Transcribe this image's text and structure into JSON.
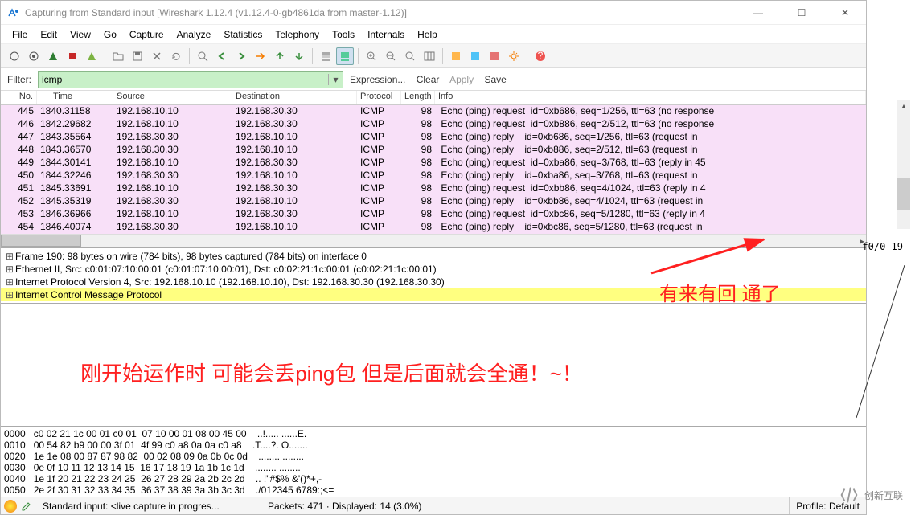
{
  "title": "Capturing from Standard input    [Wireshark 1.12.4  (v1.12.4-0-gb4861da from master-1.12)]",
  "menu": [
    "File",
    "Edit",
    "View",
    "Go",
    "Capture",
    "Analyze",
    "Statistics",
    "Telephony",
    "Tools",
    "Internals",
    "Help"
  ],
  "filter": {
    "label": "Filter:",
    "value": "icmp",
    "links": {
      "expr": "Expression...",
      "clear": "Clear",
      "apply": "Apply",
      "save": "Save"
    }
  },
  "cols": {
    "no": "No.",
    "time": "Time",
    "source": "Source",
    "dest": "Destination",
    "proto": "Protocol",
    "len": "Length",
    "info": "Info"
  },
  "packets": [
    {
      "no": "445",
      "time": "1840.31158",
      "src": "192.168.10.10",
      "dst": "192.168.30.30",
      "proto": "ICMP",
      "len": "98",
      "info": "Echo (ping) request  id=0xb686, seq=1/256, ttl=63 (no response"
    },
    {
      "no": "446",
      "time": "1842.29682",
      "src": "192.168.10.10",
      "dst": "192.168.30.30",
      "proto": "ICMP",
      "len": "98",
      "info": "Echo (ping) request  id=0xb886, seq=2/512, ttl=63 (no response"
    },
    {
      "no": "447",
      "time": "1843.35564",
      "src": "192.168.30.30",
      "dst": "192.168.10.10",
      "proto": "ICMP",
      "len": "98",
      "info": "Echo (ping) reply    id=0xb686, seq=1/256, ttl=63 (request in "
    },
    {
      "no": "448",
      "time": "1843.36570",
      "src": "192.168.30.30",
      "dst": "192.168.10.10",
      "proto": "ICMP",
      "len": "98",
      "info": "Echo (ping) reply    id=0xb886, seq=2/512, ttl=63 (request in "
    },
    {
      "no": "449",
      "time": "1844.30141",
      "src": "192.168.10.10",
      "dst": "192.168.30.30",
      "proto": "ICMP",
      "len": "98",
      "info": "Echo (ping) request  id=0xba86, seq=3/768, ttl=63 (reply in 45"
    },
    {
      "no": "450",
      "time": "1844.32246",
      "src": "192.168.30.30",
      "dst": "192.168.10.10",
      "proto": "ICMP",
      "len": "98",
      "info": "Echo (ping) reply    id=0xba86, seq=3/768, ttl=63 (request in "
    },
    {
      "no": "451",
      "time": "1845.33691",
      "src": "192.168.10.10",
      "dst": "192.168.30.30",
      "proto": "ICMP",
      "len": "98",
      "info": "Echo (ping) request  id=0xbb86, seq=4/1024, ttl=63 (reply in 4"
    },
    {
      "no": "452",
      "time": "1845.35319",
      "src": "192.168.30.30",
      "dst": "192.168.10.10",
      "proto": "ICMP",
      "len": "98",
      "info": "Echo (ping) reply    id=0xbb86, seq=4/1024, ttl=63 (request in"
    },
    {
      "no": "453",
      "time": "1846.36966",
      "src": "192.168.10.10",
      "dst": "192.168.30.30",
      "proto": "ICMP",
      "len": "98",
      "info": "Echo (ping) request  id=0xbc86, seq=5/1280, ttl=63 (reply in 4"
    },
    {
      "no": "454",
      "time": "1846.40074",
      "src": "192.168.30.30",
      "dst": "192.168.10.10",
      "proto": "ICMP",
      "len": "98",
      "info": "Echo (ping) reply    id=0xbc86, seq=5/1280, ttl=63 (request in"
    }
  ],
  "details": [
    "Frame 190: 98 bytes on wire (784 bits), 98 bytes captured (784 bits) on interface 0",
    "Ethernet II, Src: c0:01:07:10:00:01 (c0:01:07:10:00:01), Dst: c0:02:21:1c:00:01 (c0:02:21:1c:00:01)",
    "Internet Protocol Version 4, Src: 192.168.10.10 (192.168.10.10), Dst: 192.168.30.30 (192.168.30.30)",
    "Internet Control Message Protocol"
  ],
  "hex": [
    {
      "off": "0000",
      "b": "c0 02 21 1c 00 01 c0 01  07 10 00 01 08 00 45 00",
      "a": "..!..... ......E."
    },
    {
      "off": "0010",
      "b": "00 54 82 b9 00 00 3f 01  4f 99 c0 a8 0a 0a c0 a8",
      "a": ".T....?. O......."
    },
    {
      "off": "0020",
      "b": "1e 1e 08 00 87 87 98 82  00 02 08 09 0a 0b 0c 0d",
      "a": "........ ........"
    },
    {
      "off": "0030",
      "b": "0e 0f 10 11 12 13 14 15  16 17 18 19 1a 1b 1c 1d",
      "a": "........ ........"
    },
    {
      "off": "0040",
      "b": "1e 1f 20 21 22 23 24 25  26 27 28 29 2a 2b 2c 2d",
      "a": ".. !\"#$% &'()*+,-"
    },
    {
      "off": "0050",
      "b": "2e 2f 30 31 32 33 34 35  36 37 38 39 3a 3b 3c 3d",
      "a": "./012345 6789:;<="
    }
  ],
  "status": {
    "src": "Standard input: <live capture in progres...",
    "pkts": "Packets: 471 · Displayed: 14 (3.0%)",
    "profile": "Profile: Default"
  },
  "anno": {
    "top": "有来有回 通了",
    "mid": "刚开始运作时  可能会丢ping包 但是后面就会全通！~！"
  },
  "side": "f0/0  19",
  "logo": "创新互联"
}
